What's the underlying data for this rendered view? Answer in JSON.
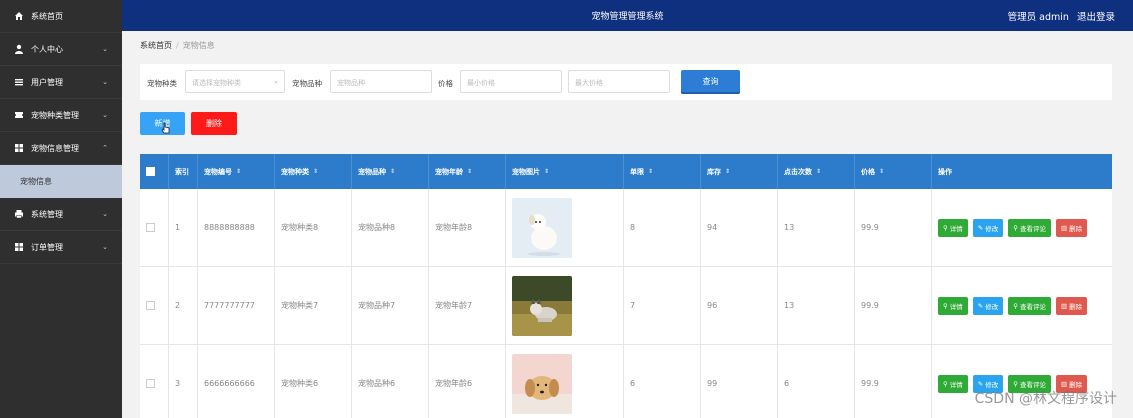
{
  "sidebar": {
    "items": [
      {
        "label": "系统首页",
        "icon": "home-icon",
        "chevron": ""
      },
      {
        "label": "个人中心",
        "icon": "user-icon",
        "chevron": "⌄"
      },
      {
        "label": "用户管理",
        "icon": "list-icon",
        "chevron": "⌄"
      },
      {
        "label": "宠物种类管理",
        "icon": "ticket-icon",
        "chevron": "⌄"
      },
      {
        "label": "宠物信息管理",
        "icon": "grid-icon",
        "chevron": "⌃"
      }
    ],
    "active_sub": "宠物信息",
    "items_after": [
      {
        "label": "系统管理",
        "icon": "printer-icon",
        "chevron": "⌄"
      },
      {
        "label": "订单管理",
        "icon": "grid-icon",
        "chevron": "⌄"
      }
    ]
  },
  "header": {
    "title": "宠物管理管理系统",
    "user": "管理员 admin",
    "logout": "退出登录"
  },
  "breadcrumb": {
    "home": "系统首页",
    "sep": "/",
    "current": "宠物信息"
  },
  "search": {
    "type_label": "宠物种类",
    "type_placeholder": "请选择宠物种类",
    "breed_label": "宠物品种",
    "breed_placeholder": "宠物品种",
    "price_label": "价格",
    "min_placeholder": "最小价格",
    "max_placeholder": "最大价格",
    "query": "查询"
  },
  "actions": {
    "add": "新增",
    "delete": "删除"
  },
  "table": {
    "headers": [
      "索引",
      "宠物编号",
      "宠物种类",
      "宠物品种",
      "宠物年龄",
      "宠物图片",
      "单限",
      "库存",
      "点击次数",
      "价格",
      "操作"
    ],
    "sort_mark": "⇕",
    "ops": {
      "detail": "详情",
      "edit": "修改",
      "review": "查看评论",
      "remove": "删除"
    },
    "rows": [
      {
        "index": "1",
        "code": "8888888888",
        "type": "宠物种类8",
        "breed": "宠物品种8",
        "age": "宠物年龄8",
        "limit": "8",
        "stock": "94",
        "clicks": "13",
        "price": "99.9"
      },
      {
        "index": "2",
        "code": "7777777777",
        "type": "宠物种类7",
        "breed": "宠物品种7",
        "age": "宠物年龄7",
        "limit": "7",
        "stock": "96",
        "clicks": "13",
        "price": "99.9"
      },
      {
        "index": "3",
        "code": "6666666666",
        "type": "宠物种类6",
        "breed": "宠物品种6",
        "age": "宠物年龄6",
        "limit": "6",
        "stock": "99",
        "clicks": "6",
        "price": "99.9"
      }
    ]
  },
  "watermark": "CSDN @林文程序设计",
  "colors": {
    "header": "#0f2f7f",
    "sidebar": "#2f2f2f",
    "table_head": "#2d7ccc",
    "query": "#2d7cd6",
    "add": "#36a3f7",
    "delete": "#ff1a1a"
  }
}
